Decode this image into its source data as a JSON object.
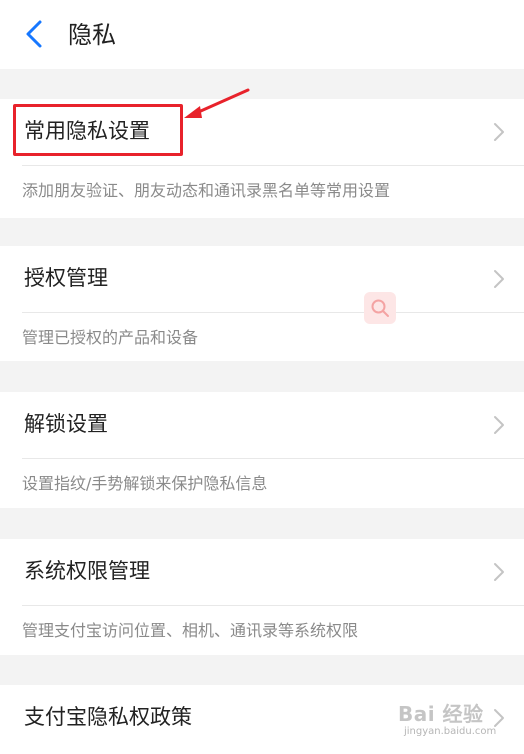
{
  "header": {
    "title": "隐私"
  },
  "items": [
    {
      "label": "常用隐私设置",
      "description": "添加朋友验证、朋友动态和通讯录黑名单等常用设置"
    },
    {
      "label": "授权管理",
      "description": "管理已授权的产品和设备"
    },
    {
      "label": "解锁设置",
      "description": "设置指纹/手势解锁来保护隐私信息"
    },
    {
      "label": "系统权限管理",
      "description": "管理支付宝访问位置、相机、通讯录等系统权限"
    },
    {
      "label": "支付宝隐私权政策"
    }
  ],
  "annotation": {
    "color": "#e8222b"
  },
  "colors": {
    "accent": "#1677ff",
    "background": "#f3f3f3",
    "text_primary": "#222222",
    "text_secondary": "#8a8a8a"
  },
  "watermark": {
    "main": "Bai 经验",
    "sub": "jingyan.baidu.com"
  }
}
